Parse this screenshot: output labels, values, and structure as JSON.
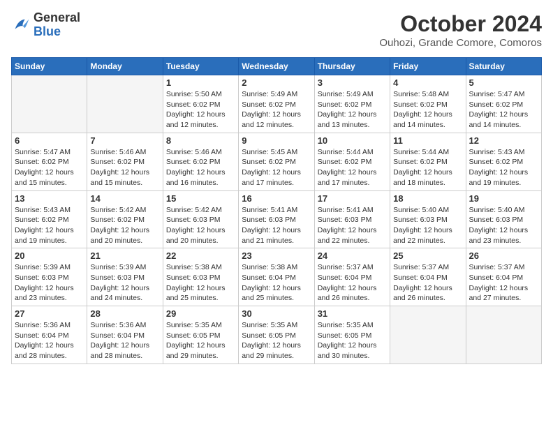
{
  "header": {
    "logo_general": "General",
    "logo_blue": "Blue",
    "month_title": "October 2024",
    "location": "Ouhozi, Grande Comore, Comoros"
  },
  "days_of_week": [
    "Sunday",
    "Monday",
    "Tuesday",
    "Wednesday",
    "Thursday",
    "Friday",
    "Saturday"
  ],
  "weeks": [
    [
      {
        "day": "",
        "empty": true
      },
      {
        "day": "",
        "empty": true
      },
      {
        "day": "1",
        "sunrise": "5:50 AM",
        "sunset": "6:02 PM",
        "daylight": "12 hours and 12 minutes."
      },
      {
        "day": "2",
        "sunrise": "5:49 AM",
        "sunset": "6:02 PM",
        "daylight": "12 hours and 12 minutes."
      },
      {
        "day": "3",
        "sunrise": "5:49 AM",
        "sunset": "6:02 PM",
        "daylight": "12 hours and 13 minutes."
      },
      {
        "day": "4",
        "sunrise": "5:48 AM",
        "sunset": "6:02 PM",
        "daylight": "12 hours and 14 minutes."
      },
      {
        "day": "5",
        "sunrise": "5:47 AM",
        "sunset": "6:02 PM",
        "daylight": "12 hours and 14 minutes."
      }
    ],
    [
      {
        "day": "6",
        "sunrise": "5:47 AM",
        "sunset": "6:02 PM",
        "daylight": "12 hours and 15 minutes."
      },
      {
        "day": "7",
        "sunrise": "5:46 AM",
        "sunset": "6:02 PM",
        "daylight": "12 hours and 15 minutes."
      },
      {
        "day": "8",
        "sunrise": "5:46 AM",
        "sunset": "6:02 PM",
        "daylight": "12 hours and 16 minutes."
      },
      {
        "day": "9",
        "sunrise": "5:45 AM",
        "sunset": "6:02 PM",
        "daylight": "12 hours and 17 minutes."
      },
      {
        "day": "10",
        "sunrise": "5:44 AM",
        "sunset": "6:02 PM",
        "daylight": "12 hours and 17 minutes."
      },
      {
        "day": "11",
        "sunrise": "5:44 AM",
        "sunset": "6:02 PM",
        "daylight": "12 hours and 18 minutes."
      },
      {
        "day": "12",
        "sunrise": "5:43 AM",
        "sunset": "6:02 PM",
        "daylight": "12 hours and 19 minutes."
      }
    ],
    [
      {
        "day": "13",
        "sunrise": "5:43 AM",
        "sunset": "6:02 PM",
        "daylight": "12 hours and 19 minutes."
      },
      {
        "day": "14",
        "sunrise": "5:42 AM",
        "sunset": "6:02 PM",
        "daylight": "12 hours and 20 minutes."
      },
      {
        "day": "15",
        "sunrise": "5:42 AM",
        "sunset": "6:03 PM",
        "daylight": "12 hours and 20 minutes."
      },
      {
        "day": "16",
        "sunrise": "5:41 AM",
        "sunset": "6:03 PM",
        "daylight": "12 hours and 21 minutes."
      },
      {
        "day": "17",
        "sunrise": "5:41 AM",
        "sunset": "6:03 PM",
        "daylight": "12 hours and 22 minutes."
      },
      {
        "day": "18",
        "sunrise": "5:40 AM",
        "sunset": "6:03 PM",
        "daylight": "12 hours and 22 minutes."
      },
      {
        "day": "19",
        "sunrise": "5:40 AM",
        "sunset": "6:03 PM",
        "daylight": "12 hours and 23 minutes."
      }
    ],
    [
      {
        "day": "20",
        "sunrise": "5:39 AM",
        "sunset": "6:03 PM",
        "daylight": "12 hours and 23 minutes."
      },
      {
        "day": "21",
        "sunrise": "5:39 AM",
        "sunset": "6:03 PM",
        "daylight": "12 hours and 24 minutes."
      },
      {
        "day": "22",
        "sunrise": "5:38 AM",
        "sunset": "6:03 PM",
        "daylight": "12 hours and 25 minutes."
      },
      {
        "day": "23",
        "sunrise": "5:38 AM",
        "sunset": "6:04 PM",
        "daylight": "12 hours and 25 minutes."
      },
      {
        "day": "24",
        "sunrise": "5:37 AM",
        "sunset": "6:04 PM",
        "daylight": "12 hours and 26 minutes."
      },
      {
        "day": "25",
        "sunrise": "5:37 AM",
        "sunset": "6:04 PM",
        "daylight": "12 hours and 26 minutes."
      },
      {
        "day": "26",
        "sunrise": "5:37 AM",
        "sunset": "6:04 PM",
        "daylight": "12 hours and 27 minutes."
      }
    ],
    [
      {
        "day": "27",
        "sunrise": "5:36 AM",
        "sunset": "6:04 PM",
        "daylight": "12 hours and 28 minutes."
      },
      {
        "day": "28",
        "sunrise": "5:36 AM",
        "sunset": "6:04 PM",
        "daylight": "12 hours and 28 minutes."
      },
      {
        "day": "29",
        "sunrise": "5:35 AM",
        "sunset": "6:05 PM",
        "daylight": "12 hours and 29 minutes."
      },
      {
        "day": "30",
        "sunrise": "5:35 AM",
        "sunset": "6:05 PM",
        "daylight": "12 hours and 29 minutes."
      },
      {
        "day": "31",
        "sunrise": "5:35 AM",
        "sunset": "6:05 PM",
        "daylight": "12 hours and 30 minutes."
      },
      {
        "day": "",
        "empty": true
      },
      {
        "day": "",
        "empty": true
      }
    ]
  ]
}
